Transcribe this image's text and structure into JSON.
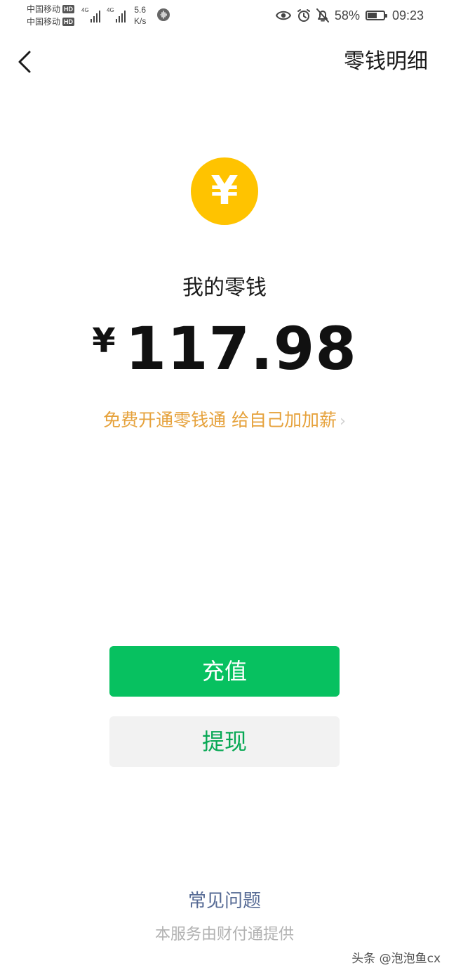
{
  "status_bar": {
    "carrier_1": "中国移动",
    "carrier_2": "中国移动",
    "hd_label": "HD",
    "network_type_1": "4G",
    "network_type_2": "4G",
    "speed_value": "5.6",
    "speed_unit": "K/s",
    "battery_percent": "58%",
    "battery_level": 0.58,
    "time": "09:23",
    "icons": [
      "eye-icon",
      "alarm-icon",
      "bell-off-icon",
      "battery-icon"
    ]
  },
  "header": {
    "back_icon": "chevron-left-icon",
    "detail_link": "零钱明细"
  },
  "main": {
    "coin_icon": "yuan-coin-icon",
    "coin_symbol": "¥",
    "balance_label": "我的零钱",
    "currency_symbol": "¥",
    "balance_amount": "117.98",
    "promo_text": "免费开通零钱通 给自己加加薪",
    "promo_chevron": "›"
  },
  "actions": {
    "recharge_label": "充值",
    "withdraw_label": "提现"
  },
  "footer": {
    "faq_link": "常见问题",
    "provider_note": "本服务由财付通提供"
  },
  "watermark": "头条 @泡泡鱼cx",
  "colors": {
    "primary_green": "#07c160",
    "coin_yellow": "#ffc300",
    "promo_orange": "#e6a23c",
    "link_blue": "#576b95",
    "muted_gray": "#b2b2b2"
  }
}
